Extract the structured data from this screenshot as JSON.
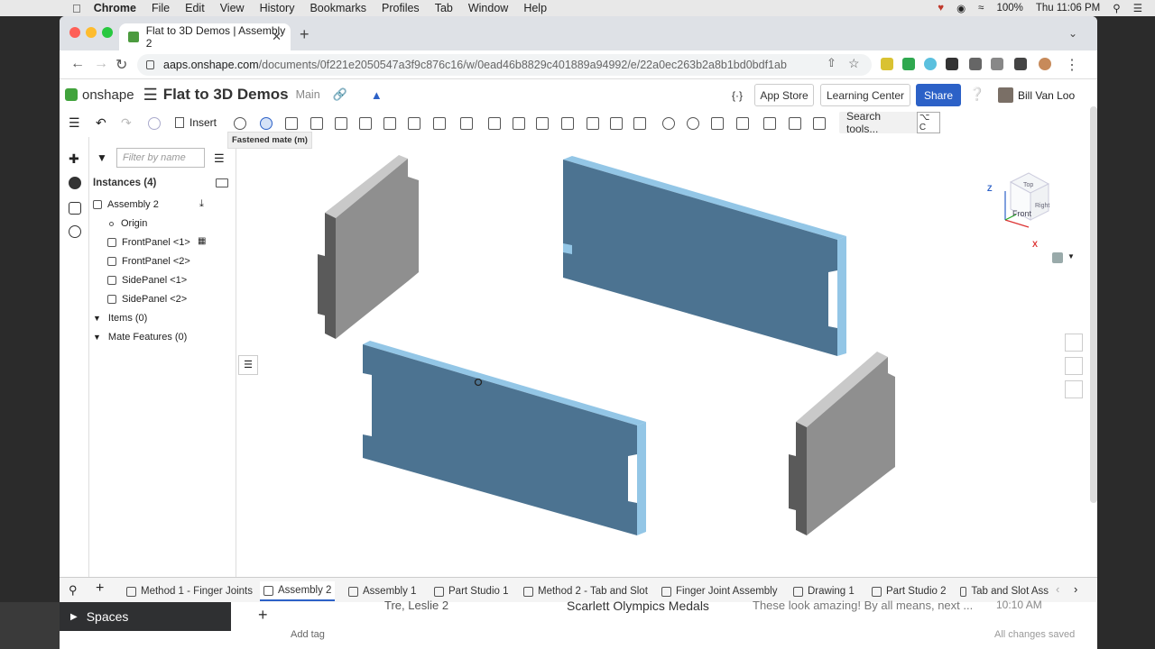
{
  "mac_menubar": {
    "items": [
      "Chrome",
      "File",
      "Edit",
      "View",
      "History",
      "Bookmarks",
      "Profiles",
      "Tab",
      "Window",
      "Help"
    ],
    "battery": "100%",
    "clock": "Thu 11:06 PM"
  },
  "browser": {
    "tab_title": "Flat to 3D Demos | Assembly 2",
    "url_host": "aaps.onshape.com",
    "url_path": "/documents/0f221e2050547a3f9c876c16/w/0ead46b8829c401889a94992/e/22a0ec263b2a8b1bd0bdf1ab"
  },
  "app_header": {
    "brand": "onshape",
    "doc_title": "Flat to 3D Demos",
    "branch": "Main",
    "app_store": "App Store",
    "learning_center": "Learning Center",
    "share": "Share",
    "user": "Bill Van Loo",
    "curly": "{·}"
  },
  "toolbar": {
    "insert": "Insert",
    "search_tools": "Search tools...",
    "shortcut": "⌥ C",
    "tooltip": "Fastened mate (m)"
  },
  "panel": {
    "filter_placeholder": "Filter by name",
    "instances_header": "Instances (4)",
    "tree": [
      {
        "label": "Assembly 2"
      },
      {
        "label": "Origin"
      },
      {
        "label": "FrontPanel <1>"
      },
      {
        "label": "FrontPanel <2>"
      },
      {
        "label": "SidePanel <1>"
      },
      {
        "label": "SidePanel <2>"
      }
    ],
    "items": "Items (0)",
    "mate_features": "Mate Features (0)"
  },
  "viewcube": {
    "top": "Top",
    "front": "Front",
    "right": "Right",
    "z": "Z",
    "x": "X"
  },
  "bottom_tabs": [
    {
      "label": "Method 1 - Finger Joints"
    },
    {
      "label": "Assembly 2"
    },
    {
      "label": "Assembly 1"
    },
    {
      "label": "Part Studio 1"
    },
    {
      "label": "Method 2 - Tab and Slot"
    },
    {
      "label": "Finger Joint Assembly"
    },
    {
      "label": "Drawing 1"
    },
    {
      "label": "Part Studio 2"
    },
    {
      "label": "Tab and Slot Ass"
    }
  ],
  "below": {
    "spaces": "Spaces",
    "email_from": "Tre, Leslie 2",
    "email_subject": "Scarlett Olympics Medals",
    "email_snippet": "These look amazing! By all means, next ...",
    "email_time": "10:10 AM",
    "add_tag": "Add tag",
    "saved": "All changes saved"
  },
  "colors": {
    "panel_blue": "#4c7391",
    "panel_edge": "#93c6e6",
    "panel_gray": "#8f8f8f",
    "panel_gray_dark": "#5a5a5a",
    "accent": "#2c61c7"
  }
}
